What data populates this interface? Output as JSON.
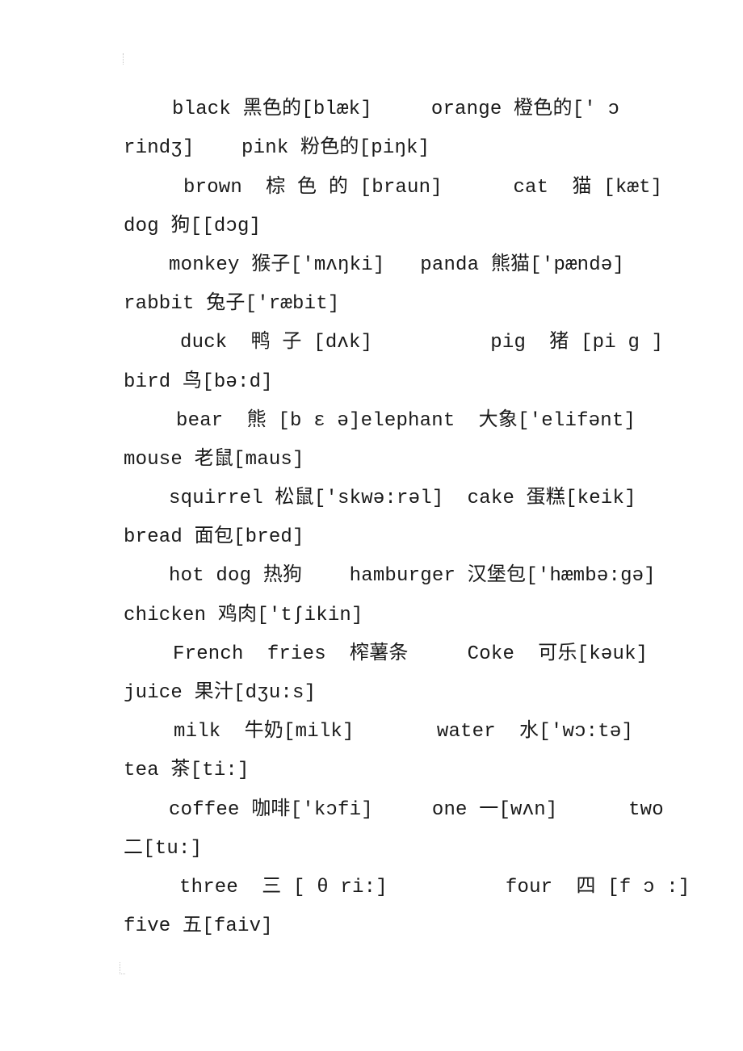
{
  "document": {
    "lines": [
      "black 黑色的[blæk]     orange 橙色的[' ɔ",
      "rindʒ]    pink 粉色的[piŋk]",
      "brown  棕 色 的 [braun]      cat  猫 [kæt]",
      "dog 狗[[dɔg]",
      "monkey 猴子['mʌŋki]   panda 熊猫['pændə]",
      "rabbit 兔子['ræbit]",
      "duck  鸭 子 [dʌk]          pig  猪 [pi g ]",
      "bird 鸟[bə:d]",
      "bear  熊 [b ɛ ə]elephant  大象['elifənt]",
      "mouse 老鼠[maus]",
      "squirrel 松鼠['skwə:rəl]  cake 蛋糕[keik]",
      "bread 面包[bred]",
      "hot dog 热狗    hamburger 汉堡包['hæmbə:gə]",
      "chicken 鸡肉['tʃikin]",
      "French  fries  榨薯条     Coke  可乐[kəuk]",
      "juice 果汁[dʒu:s]",
      "milk  牛奶[milk]       water  水['wɔ:tə]",
      "tea 茶[ti:]",
      "coffee 咖啡['kɔfi]     one 一[wʌn]      two",
      "二[tu:]",
      "three  三 [ θ ri:]          four  四 [f ɔ :]",
      "five 五[faiv]"
    ]
  }
}
